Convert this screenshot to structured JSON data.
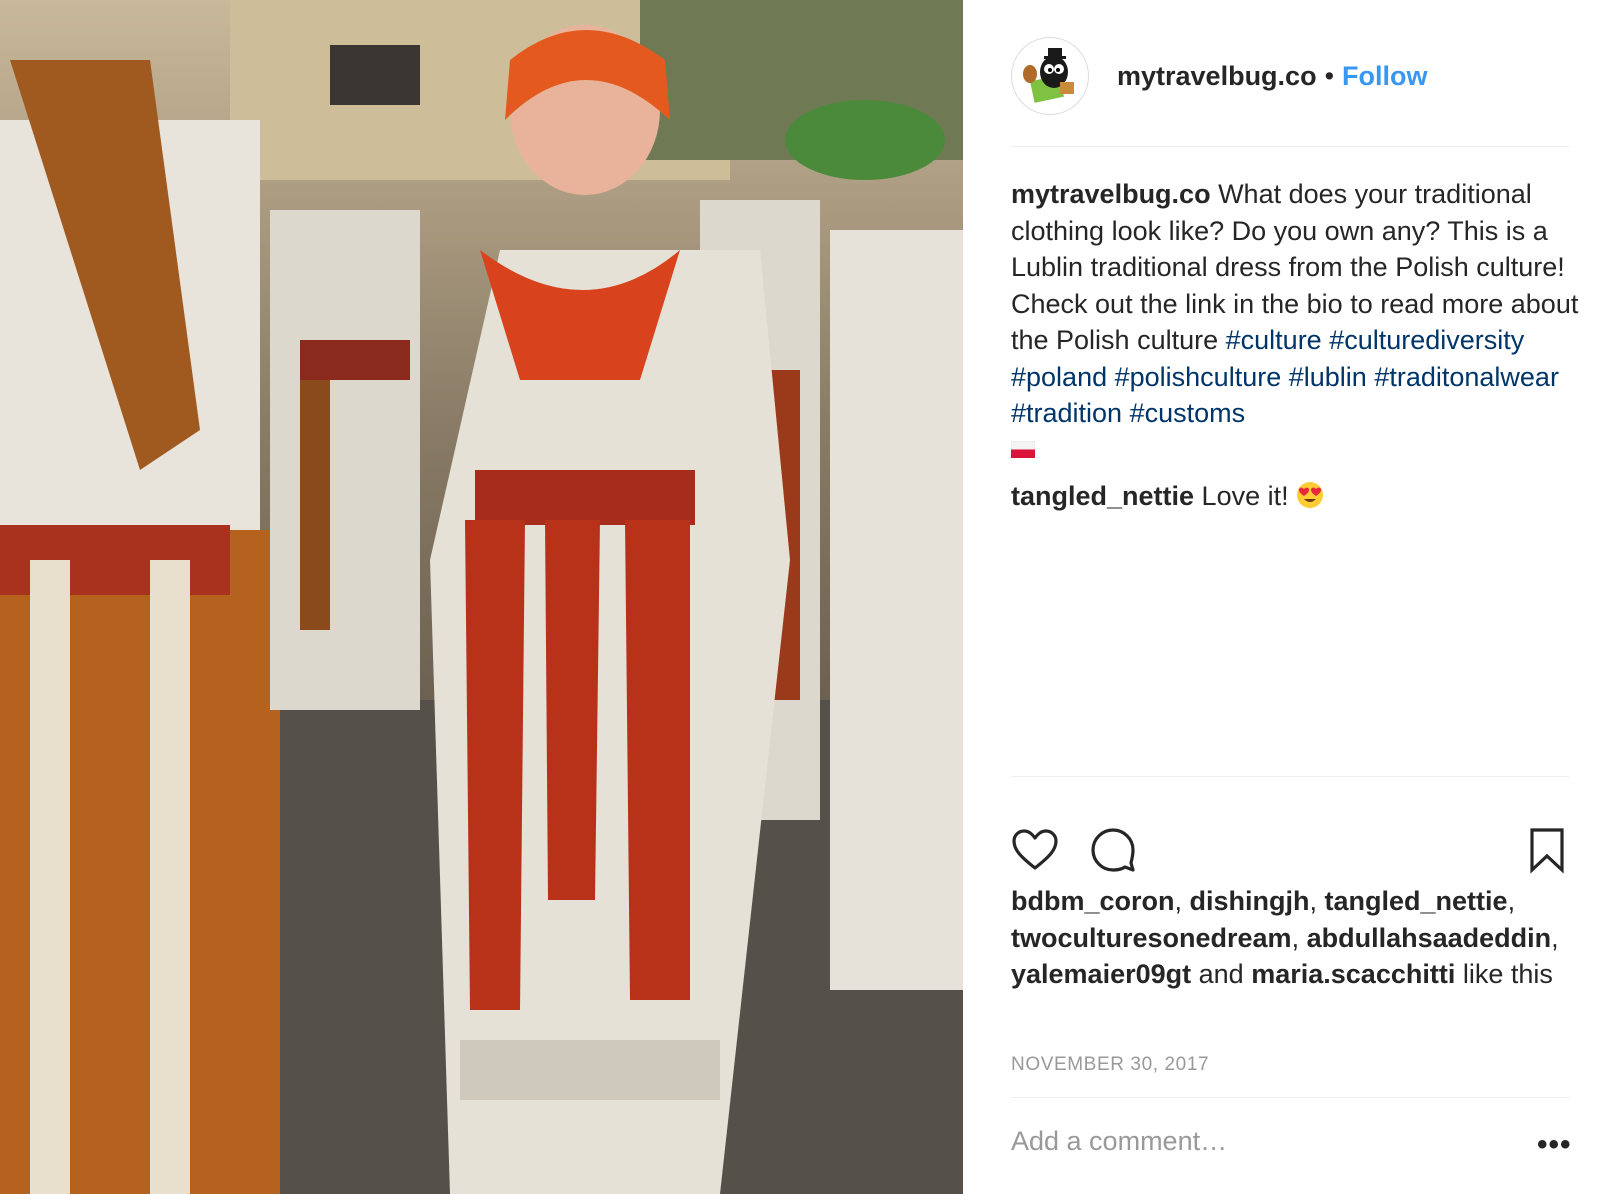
{
  "post": {
    "image_alt": "Women in Lublin traditional Polish dress with red woven sashes at a street festival",
    "author": {
      "username": "mytravelbug.co",
      "separator": "•",
      "follow_label": "Follow",
      "avatar_icon": "bug-logo-icon"
    },
    "caption": {
      "username": "mytravelbug.co",
      "text": "What does your traditional clothing look like? Do you own any? This is a Lublin traditional dress from the Polish culture! Check out the link in the bio to read more about the Polish culture",
      "hashtags": [
        "#culture",
        "#culturediversity",
        "#poland",
        "#polishculture",
        "#lublin",
        "#traditonalwear",
        "#tradition",
        "#customs"
      ],
      "flag_icon": "poland-flag-icon"
    },
    "comments": [
      {
        "username": "tangled_nettie",
        "text": "Love it!",
        "emoji_icon": "heart-eyes-emoji-icon"
      }
    ],
    "actions": {
      "like_icon": "heart-icon",
      "comment_icon": "speech-bubble-icon",
      "save_icon": "bookmark-icon"
    },
    "likes": {
      "users": [
        "bdbm_coron",
        "dishingjh",
        "tangled_nettie",
        "twoculturesonedream",
        "abdullahsaadeddin",
        "yalemaier09gt",
        "maria.scacchitti"
      ],
      "connector": "and",
      "suffix": "like this"
    },
    "date": "NOVEMBER 30, 2017",
    "add_comment_placeholder": "Add a comment…",
    "more_label": "•••"
  },
  "colors": {
    "link_blue": "#3897f0",
    "hashtag_blue": "#003569",
    "text": "#262626",
    "muted": "#999999",
    "sash_red": "#b8321a"
  }
}
